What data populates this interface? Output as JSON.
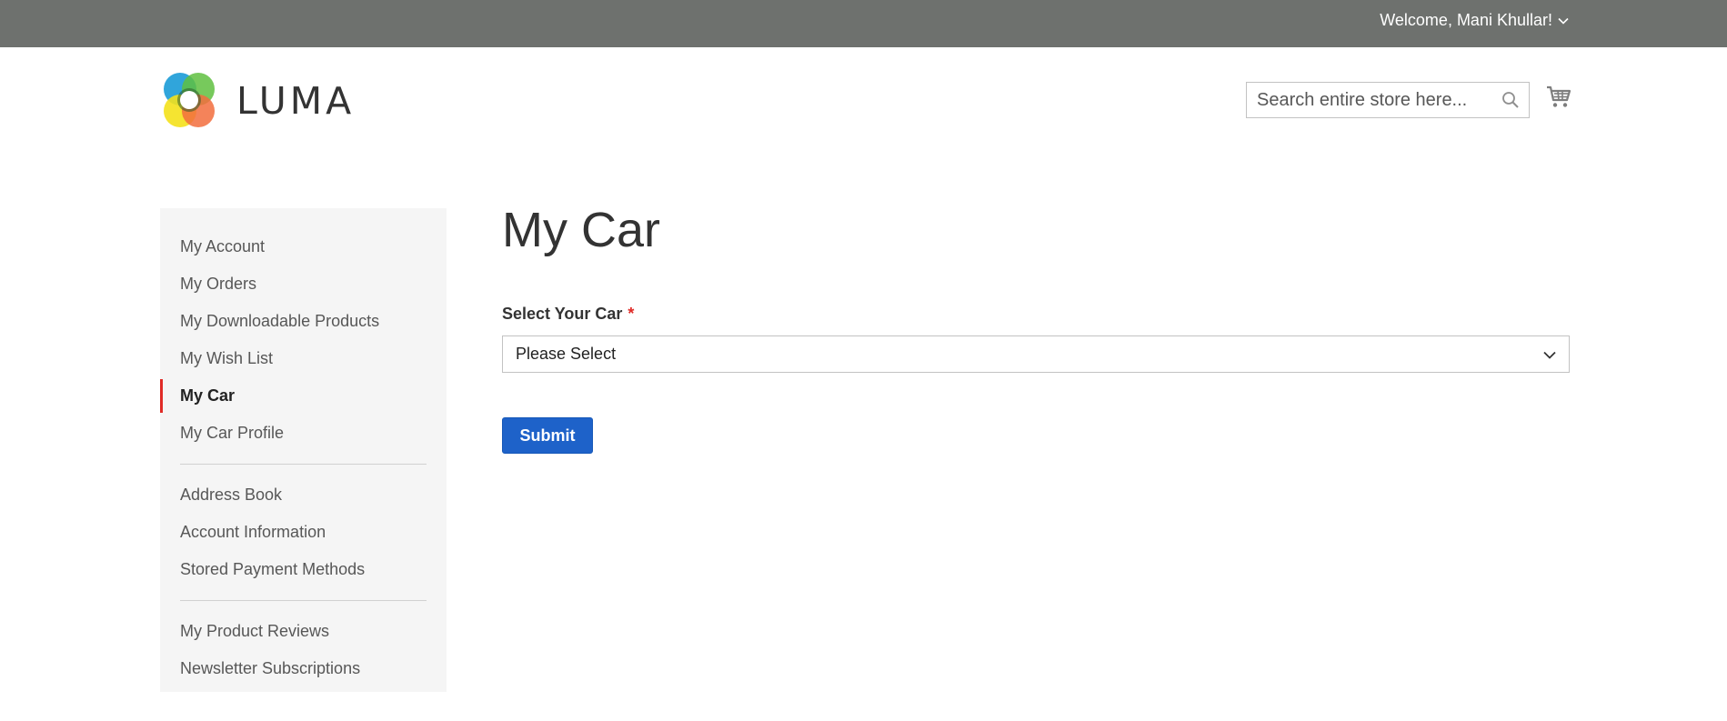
{
  "top_panel": {
    "welcome_text": "Welcome, Mani Khullar!",
    "dropdown_icon": "chevron-down-icon"
  },
  "header": {
    "logo_text": "LUMA",
    "search_placeholder": "Search entire store here...",
    "search_icon": "search-icon",
    "cart_icon": "cart-icon"
  },
  "sidebar": {
    "group1": [
      {
        "label": "My Account"
      },
      {
        "label": "My Orders"
      },
      {
        "label": "My Downloadable Products"
      },
      {
        "label": "My Wish List"
      },
      {
        "label": "My Car",
        "active": true
      },
      {
        "label": "My Car Profile"
      }
    ],
    "group2": [
      {
        "label": "Address Book"
      },
      {
        "label": "Account Information"
      },
      {
        "label": "Stored Payment Methods"
      }
    ],
    "group3": [
      {
        "label": "My Product Reviews"
      },
      {
        "label": "Newsletter Subscriptions"
      }
    ]
  },
  "main": {
    "title": "My Car",
    "field_label": "Select Your Car",
    "required_marker": "*",
    "select_value": "Please Select",
    "submit_label": "Submit"
  },
  "colors": {
    "top_panel_bg": "#6e716e",
    "active_marker": "#e02b27",
    "primary_button": "#1e62c9",
    "sidebar_bg": "#f5f5f5"
  }
}
